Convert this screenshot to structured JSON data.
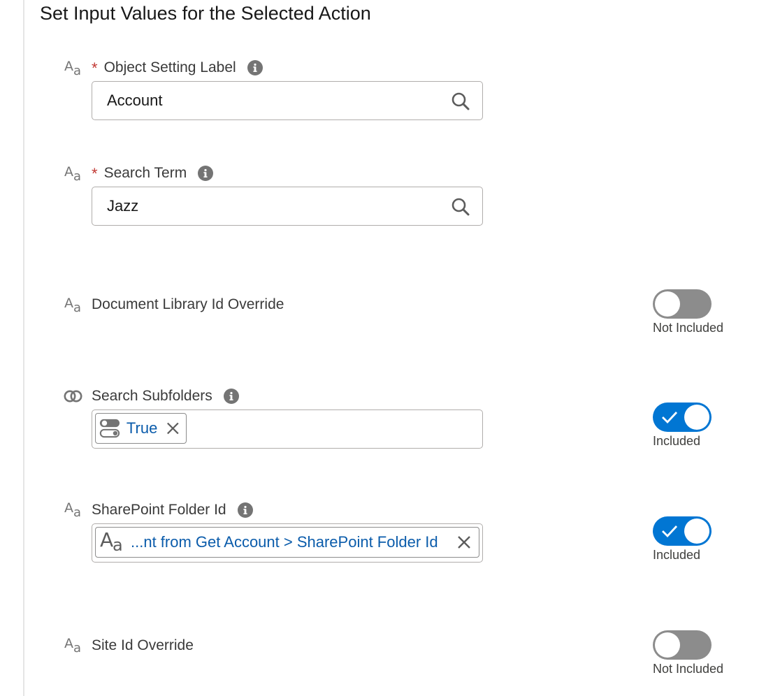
{
  "section": {
    "title": "Set Input Values for the Selected Action"
  },
  "fields": {
    "object_setting_label": {
      "label": "Object Setting Label",
      "required_mark": "*",
      "value": "Account"
    },
    "search_term": {
      "label": "Search Term",
      "required_mark": "*",
      "value": "Jazz"
    },
    "document_library_id_override": {
      "label": "Document Library Id Override",
      "toggle_state": "off",
      "toggle_caption": "Not Included"
    },
    "search_subfolders": {
      "label": "Search Subfolders",
      "pill_value": "True",
      "toggle_state": "on",
      "toggle_caption": "Included"
    },
    "sharepoint_folder_id": {
      "label": "SharePoint Folder Id",
      "pill_value": "...nt from Get Account > SharePoint Folder Id",
      "toggle_state": "on",
      "toggle_caption": "Included"
    },
    "site_id_override": {
      "label": "Site Id Override",
      "toggle_state": "off",
      "toggle_caption": "Not Included"
    }
  },
  "icons": {
    "text_type": "text-type-icon",
    "boolean_type": "boolean-type-icon",
    "info": "info-icon",
    "search": "search-icon",
    "close": "close-icon",
    "check": "check-icon",
    "toggle_resource": "toggle-resource-icon"
  },
  "colors": {
    "accent": "#0176d3",
    "pill_text": "#0b5cab",
    "toggle_off": "#8c8c8c",
    "required": "#c23934"
  }
}
